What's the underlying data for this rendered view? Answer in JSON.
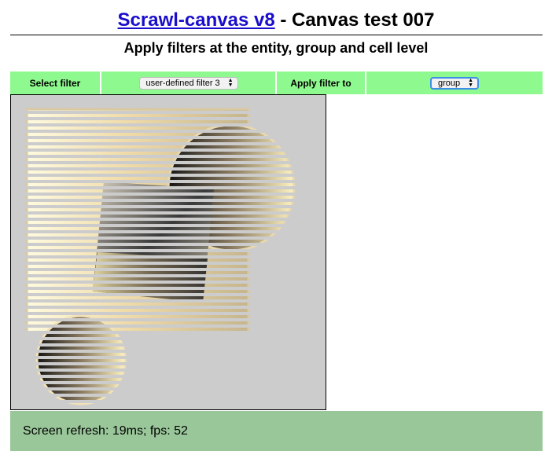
{
  "header": {
    "title_link": "Scrawl-canvas v8",
    "title_rest": " - Canvas test 007",
    "subtitle": "Apply filters at the entity, group and cell level"
  },
  "controls": {
    "select_filter_label": "Select filter",
    "filter_value": "user-defined filter 3",
    "apply_to_label": "Apply filter to",
    "apply_to_value": "group"
  },
  "status": {
    "text": "Screen refresh: 19ms; fps: 52"
  },
  "colors": {
    "control_bg": "#8ef98e",
    "status_bg": "#9ac79a",
    "canvas_bg": "#cccccc",
    "link": "#1a0dcc"
  }
}
